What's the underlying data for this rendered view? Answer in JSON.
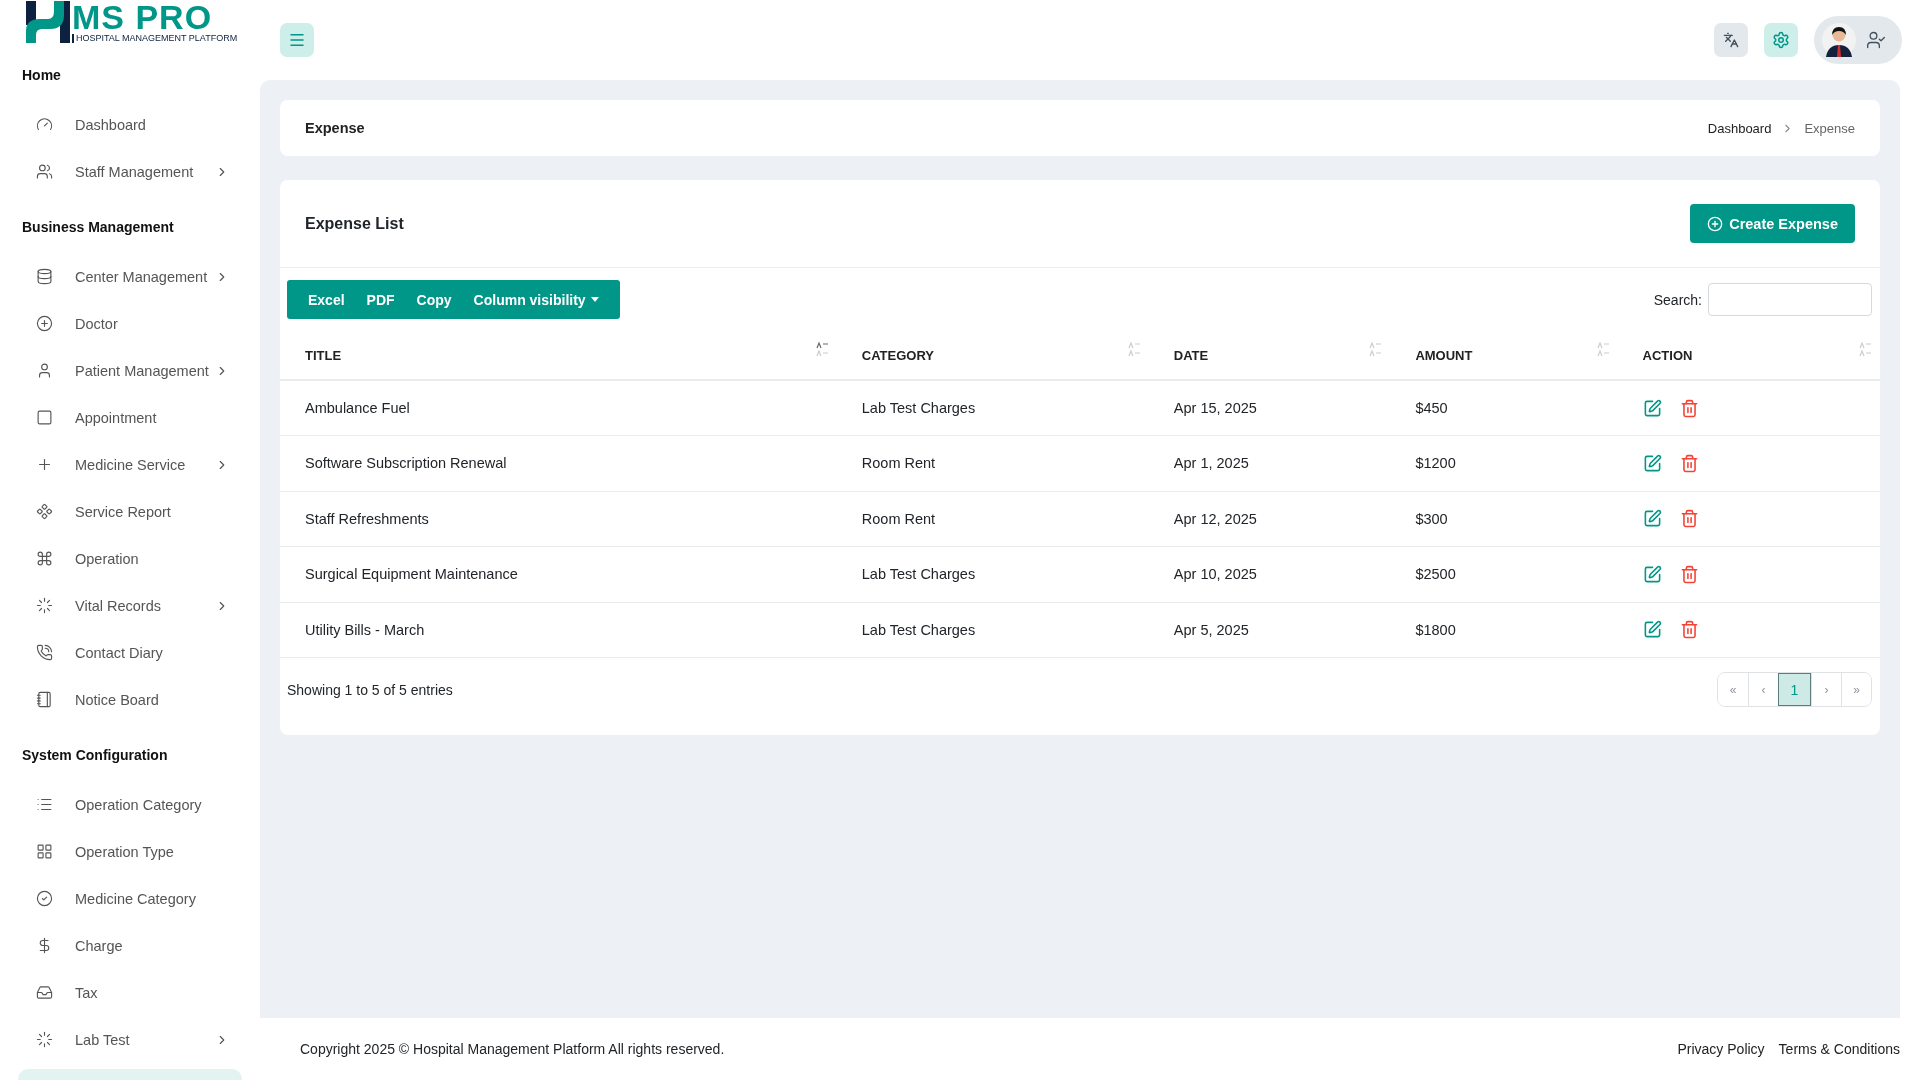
{
  "brand": {
    "name": "MS PRO",
    "tagline": "HOSPITAL MANAGEMENT PLATFORM"
  },
  "sidebar": {
    "sections": [
      {
        "title": "Home",
        "items": [
          {
            "label": "Dashboard",
            "has_submenu": false
          },
          {
            "label": "Staff Management",
            "has_submenu": true
          }
        ]
      },
      {
        "title": "Business Management",
        "items": [
          {
            "label": "Center Management",
            "has_submenu": true
          },
          {
            "label": "Doctor",
            "has_submenu": false
          },
          {
            "label": "Patient Management",
            "has_submenu": true
          },
          {
            "label": "Appointment",
            "has_submenu": false
          },
          {
            "label": "Medicine Service",
            "has_submenu": true
          },
          {
            "label": "Service Report",
            "has_submenu": false
          },
          {
            "label": "Operation",
            "has_submenu": false
          },
          {
            "label": "Vital Records",
            "has_submenu": true
          },
          {
            "label": "Contact Diary",
            "has_submenu": false
          },
          {
            "label": "Notice Board",
            "has_submenu": false
          }
        ]
      },
      {
        "title": "System Configuration",
        "items": [
          {
            "label": "Operation Category",
            "has_submenu": false
          },
          {
            "label": "Operation Type",
            "has_submenu": false
          },
          {
            "label": "Medicine Category",
            "has_submenu": false
          },
          {
            "label": "Charge",
            "has_submenu": false
          },
          {
            "label": "Tax",
            "has_submenu": false
          },
          {
            "label": "Lab Test",
            "has_submenu": true
          }
        ]
      }
    ]
  },
  "page_header": {
    "title": "Expense",
    "breadcrumb": [
      {
        "label": "Dashboard",
        "current": false
      },
      {
        "label": "Expense",
        "current": true
      }
    ]
  },
  "card": {
    "title": "Expense List",
    "create_button": "Create Expense"
  },
  "export_buttons": [
    {
      "label": "Excel",
      "dropdown": false
    },
    {
      "label": "PDF",
      "dropdown": false
    },
    {
      "label": "Copy",
      "dropdown": false
    },
    {
      "label": "Column visibility",
      "dropdown": true
    }
  ],
  "search": {
    "label": "Search:"
  },
  "table": {
    "columns": [
      {
        "label": "TITLE",
        "sorted": true
      },
      {
        "label": "CATEGORY",
        "sorted": false
      },
      {
        "label": "DATE",
        "sorted": false
      },
      {
        "label": "AMOUNT",
        "sorted": false
      },
      {
        "label": "ACTION",
        "sorted": false
      }
    ],
    "rows": [
      {
        "title": "Ambulance Fuel",
        "category": "Lab Test Charges",
        "date": "Apr 15, 2025",
        "amount": "$450"
      },
      {
        "title": "Software Subscription Renewal",
        "category": "Room Rent",
        "date": "Apr 1, 2025",
        "amount": "$1200"
      },
      {
        "title": "Staff Refreshments",
        "category": "Room Rent",
        "date": "Apr 12, 2025",
        "amount": "$300"
      },
      {
        "title": "Surgical Equipment Maintenance",
        "category": "Lab Test Charges",
        "date": "Apr 10, 2025",
        "amount": "$2500"
      },
      {
        "title": "Utility Bills - March",
        "category": "Lab Test Charges",
        "date": "Apr 5, 2025",
        "amount": "$1800"
      }
    ]
  },
  "table_info": "Showing 1 to 5 of 5 entries",
  "pagination": [
    {
      "label": "«",
      "selected": false
    },
    {
      "label": "‹",
      "selected": false
    },
    {
      "label": "1",
      "selected": true
    },
    {
      "label": "›",
      "selected": false
    },
    {
      "label": "»",
      "selected": false
    }
  ],
  "footer": {
    "copyright": "Copyright 2025 © Hospital Management Platform All rights reserved.",
    "links": [
      "Privacy Policy",
      "Terms & Conditions"
    ]
  }
}
